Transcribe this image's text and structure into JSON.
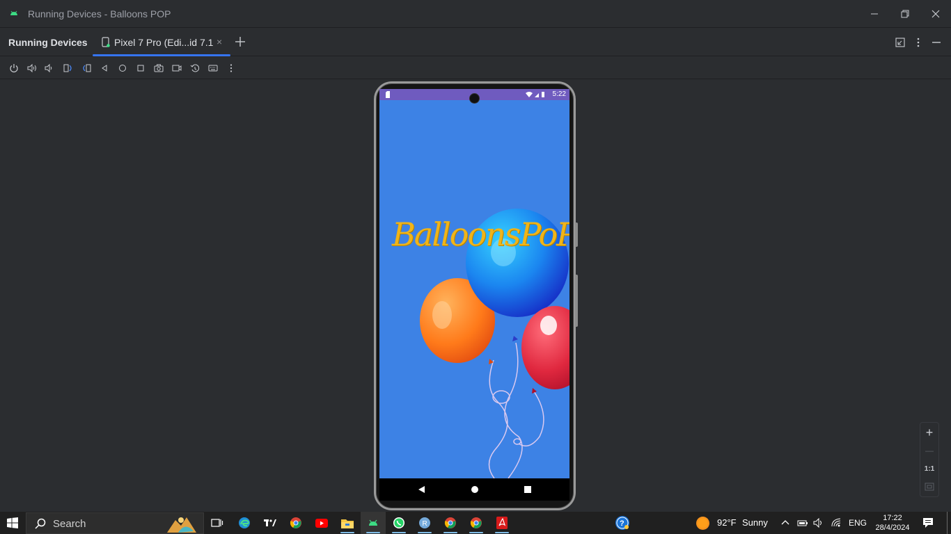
{
  "window": {
    "title": "Running Devices - Balloons POP",
    "minimize_icon": "minimize-icon",
    "restore_icon": "restore-icon",
    "close_icon": "close-icon"
  },
  "tool_window": {
    "title": "Running Devices",
    "tab_label": "Pixel 7 Pro (Edi...id 7.1",
    "tab_close": "×",
    "add_tab_icon": "plus-icon"
  },
  "toolbar": {
    "icons": [
      "power-icon",
      "volume-up-icon",
      "volume-down-icon",
      "rotate-left-icon",
      "rotate-right-icon",
      "back-icon",
      "home-icon",
      "overview-icon",
      "screenshot-icon",
      "screen-record-icon",
      "reset-icon",
      "keyboard-icon",
      "more-icon"
    ]
  },
  "device": {
    "status_time": "5:22",
    "app_title": "BalloonsPoP",
    "nav_icons": [
      "back-triangle-icon",
      "home-circle-icon",
      "recents-square-icon"
    ],
    "screen_color": "#3d82e5",
    "statusbar_color": "#6f5bbf"
  },
  "zoom": {
    "zoom_in": "+",
    "zoom_out": "—",
    "actual_size": "1:1",
    "fit_icon": "fit-screen-icon"
  },
  "taskbar": {
    "search_label": "Search",
    "weather_temp": "92°F",
    "weather_desc": "Sunny",
    "language": "ENG",
    "time": "17:22",
    "date": "28/4/2024"
  },
  "colors": {
    "accent": "#3574f0",
    "ide_bg": "#2b2d30",
    "taskbar_bg": "#202020"
  }
}
